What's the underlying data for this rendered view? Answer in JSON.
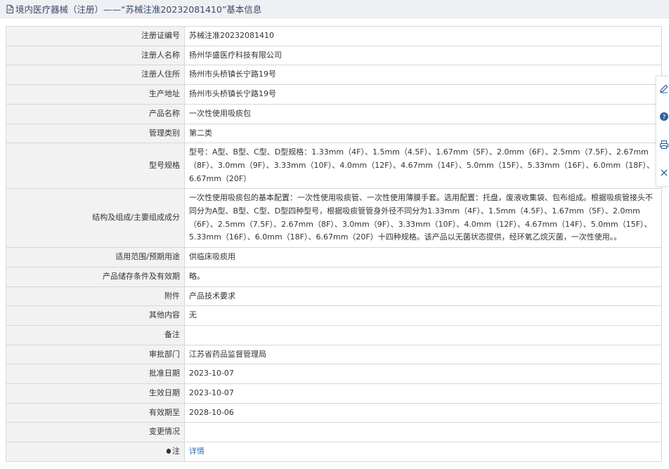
{
  "header": {
    "title": "境内医疗器械（注册）——“苏械注准20232081410”基本信息"
  },
  "rows": [
    {
      "label": "注册证编号",
      "value": "苏械注准20232081410"
    },
    {
      "label": "注册人名称",
      "value": "扬州华盛医疗科技有限公司"
    },
    {
      "label": "注册人住所",
      "value": "扬州市头桥镇长宁路19号"
    },
    {
      "label": "生产地址",
      "value": "扬州市头桥镇长宁路19号"
    },
    {
      "label": "产品名称",
      "value": "一次性使用吸痰包"
    },
    {
      "label": "管理类别",
      "value": "第二类"
    },
    {
      "label": "型号规格",
      "value": "型号：A型、B型、C型、D型规格：1.33mm（4F）、1.5mm（4.5F）、1.67mm（5F）、2.0mm（6F）、2.5mm（7.5F）、2.67mm（8F）、3.0mm（9F）、3.33mm（10F）、4.0mm（12F）、4.67mm（14F）、5.0mm（15F）、5.33mm（16F）、6.0mm（18F）、6.67mm（20F）"
    },
    {
      "label": "结构及组成/主要组成成分",
      "value": "一次性使用吸痰包的基本配置：一次性使用吸痰管、一次性使用薄膜手套。选用配置：托盘，废液收集袋、包布组成。根据吸痰管接头不同分为A型、B型、C型、D型四种型号，根据吸痰管管身外径不同分为1.33mm（4F）、1.5mm（4.5F）、1.67mm（5F）、2.0mm（6F）、2.5mm（7.5F）、2.67mm（8F）、3.0mm（9F）、3.33mm（10F）、4.0mm（12F）、4.67mm（14F）、5.0mm（15F）、5.33mm（16F）、6.0mm（18F）、6.67mm（20F）十四种规格。该产品以无菌状态提供，经环氧乙烷灭菌，一次性使用。。"
    },
    {
      "label": "适用范围/预期用途",
      "value": "供临床吸痰用"
    },
    {
      "label": "产品储存条件及有效期",
      "value": "略。"
    },
    {
      "label": "附件",
      "value": "产品技术要求"
    },
    {
      "label": "其他内容",
      "value": "无"
    },
    {
      "label": "备注",
      "value": ""
    },
    {
      "label": "审批部门",
      "value": "江苏省药品监督管理局"
    },
    {
      "label": "批准日期",
      "value": "2023-10-07"
    },
    {
      "label": "生效日期",
      "value": "2023-10-07"
    },
    {
      "label": "有效期至",
      "value": "2028-10-06"
    },
    {
      "label": "变更情况",
      "value": ""
    }
  ],
  "note_row": {
    "label": "注",
    "link": "详情"
  },
  "icons": {
    "header": "document-icon",
    "note": "lightbulb-icon",
    "side_tools": [
      "edit-icon",
      "help-icon",
      "print-icon",
      "close-icon"
    ]
  },
  "colors": {
    "link": "#2d6ebf",
    "label_bg": "#f2f2f2",
    "header_bg": "#eef0f4"
  }
}
